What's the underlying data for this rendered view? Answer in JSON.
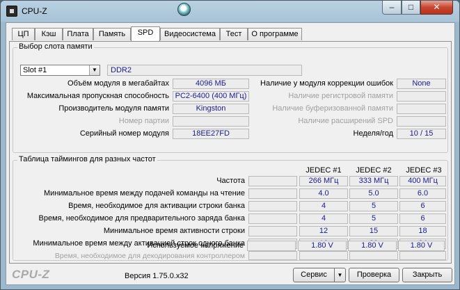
{
  "window": {
    "title": "CPU-Z",
    "controls": {
      "minimize": "–",
      "maximize": "□",
      "close": "✕"
    }
  },
  "tabs": [
    "ЦП",
    "Кэш",
    "Плата",
    "Память",
    "SPD",
    "Видеосистема",
    "Тест",
    "О программе"
  ],
  "active_tab": "SPD",
  "slot_group": {
    "title": "Выбор слота памяти",
    "slot_select": "Slot #1",
    "memory_type": "DDR2",
    "rows": [
      {
        "label": "Объём модуля в мегабайтах",
        "value": "4096 МБ"
      },
      {
        "label": "Максимальная пропускная способность",
        "value": "PC2-6400 (400 МГц)"
      },
      {
        "label": "Производитель модуля памяти",
        "value": "Kingston"
      },
      {
        "label": "Номер партии",
        "value": ""
      },
      {
        "label": "Серийный номер модуля",
        "value": "18EE27FD"
      }
    ],
    "right_rows": [
      {
        "label": "Наличие у модуля коррекции ошибок",
        "value": "None"
      },
      {
        "label": "Наличие регистровой памяти",
        "value": ""
      },
      {
        "label": "Наличие буферизованной памяти",
        "value": ""
      },
      {
        "label": "Наличие расширений SPD",
        "value": ""
      },
      {
        "label": "Неделя/год",
        "value": "10 / 15"
      }
    ]
  },
  "timings_group": {
    "title": "Таблица таймингов для разных частот",
    "columns": [
      "JEDEC #1",
      "JEDEC #2",
      "JEDEC #3",
      ""
    ],
    "rows": [
      {
        "label": "Частота",
        "values": [
          "266 МГц",
          "333 МГц",
          "400 МГц",
          ""
        ]
      },
      {
        "label": "Минимальное время между подачей команды на чтение",
        "values": [
          "4.0",
          "5.0",
          "6.0",
          ""
        ]
      },
      {
        "label": "Время, необходимое для активации строки банка",
        "values": [
          "4",
          "5",
          "6",
          ""
        ]
      },
      {
        "label": "Время, необходимое для предварительного заряда банка",
        "values": [
          "4",
          "5",
          "6",
          ""
        ]
      },
      {
        "label": "Минимальное время активности строки",
        "values": [
          "12",
          "15",
          "18",
          ""
        ]
      },
      {
        "label": "Минимальное время между активацией строк одного банка",
        "values": [
          "16",
          "20",
          "24",
          ""
        ]
      },
      {
        "label": "Время, необходимое для декодирования контроллером",
        "values": [
          "",
          "",
          "",
          ""
        ]
      },
      {
        "label": "Используемое напряжение",
        "values": [
          "1.80 V",
          "1.80 V",
          "1.80 V",
          ""
        ]
      }
    ]
  },
  "footer": {
    "logo": "CPU-Z",
    "version": "Версия 1.75.0.x32",
    "service_button": "Сервис",
    "validate_button": "Проверка",
    "close_button": "Закрыть"
  }
}
